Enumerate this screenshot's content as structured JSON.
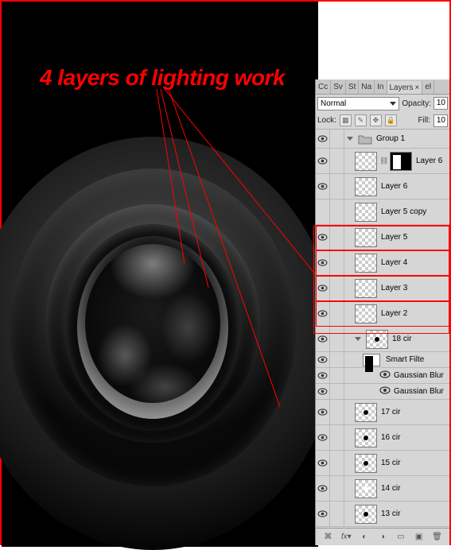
{
  "annotation": "4 layers of lighting work",
  "tabs": [
    "Cc",
    "Sv",
    "St",
    "Na",
    "In",
    "Layers",
    "el"
  ],
  "active_tab": "Layers",
  "blend_mode": "Normal",
  "opacity_label": "Opacity:",
  "opacity_value": "10",
  "lock_label": "Lock:",
  "fill_label": "Fill:",
  "fill_value": "10",
  "layers": [
    {
      "name": "Group 1",
      "type": "group",
      "vis": true,
      "expanded": true,
      "indent": 0
    },
    {
      "name": "Layer 6",
      "type": "layer",
      "vis": true,
      "indent": 1,
      "mask": true,
      "fx": true
    },
    {
      "name": "Layer 6",
      "type": "layer",
      "vis": true,
      "indent": 1
    },
    {
      "name": "Layer 5 copy",
      "type": "layer",
      "vis": false,
      "indent": 1
    },
    {
      "name": "Layer 5",
      "type": "layer",
      "vis": true,
      "indent": 1,
      "hl": true
    },
    {
      "name": "Layer 4",
      "type": "layer",
      "vis": true,
      "indent": 1,
      "hl": true
    },
    {
      "name": "Layer 3",
      "type": "layer",
      "vis": true,
      "indent": 1,
      "hl": true
    },
    {
      "name": "Layer 2",
      "type": "layer",
      "vis": true,
      "indent": 1,
      "hl": true
    },
    {
      "name": "18 cir",
      "type": "smart",
      "vis": true,
      "indent": 1,
      "expanded": true
    },
    {
      "name": "Smart Filte",
      "type": "sf-header",
      "vis": true,
      "indent": 2
    },
    {
      "name": "Gaussian Blur",
      "type": "sf",
      "vis": true,
      "indent": 2
    },
    {
      "name": "Gaussian Blur",
      "type": "sf",
      "vis": true,
      "indent": 2
    },
    {
      "name": "17 cir",
      "type": "layer",
      "vis": true,
      "indent": 1,
      "dot": "b"
    },
    {
      "name": "16 cir",
      "type": "layer",
      "vis": true,
      "indent": 1,
      "dot": "b"
    },
    {
      "name": "15 cir",
      "type": "layer",
      "vis": true,
      "indent": 1,
      "dot": "b"
    },
    {
      "name": "14 cir",
      "type": "layer",
      "vis": true,
      "indent": 1,
      "dot": "w"
    },
    {
      "name": "13 cir",
      "type": "layer",
      "vis": true,
      "indent": 1,
      "dot": "b"
    }
  ],
  "bottom_icons": [
    "link",
    "fx",
    "mask",
    "adjust",
    "group",
    "new",
    "trash"
  ]
}
